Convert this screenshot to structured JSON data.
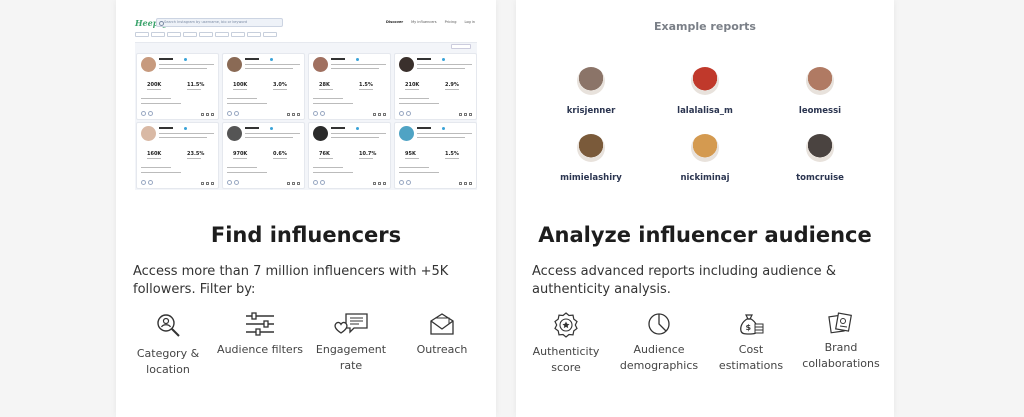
{
  "left": {
    "mini_app": {
      "logo": "Heepsy",
      "search_placeholder": "Search Instagram by username, bio or keyword",
      "nav": [
        "Discover",
        "My influencers",
        "Pricing",
        "Log in"
      ],
      "cards": [
        {
          "followers": "200K",
          "engagement": "11.5%",
          "avatar_color": "#c79a7e"
        },
        {
          "followers": "100K",
          "engagement": "3.0%",
          "avatar_color": "#8a6a55"
        },
        {
          "followers": "28K",
          "engagement": "1.5%",
          "avatar_color": "#a07060"
        },
        {
          "followers": "210K",
          "engagement": "2.9%",
          "avatar_color": "#3a302c"
        },
        {
          "followers": "160K",
          "engagement": "23.5%",
          "avatar_color": "#d9b9a5"
        },
        {
          "followers": "970K",
          "engagement": "0.6%",
          "avatar_color": "#555555"
        },
        {
          "followers": "76K",
          "engagement": "10.7%",
          "avatar_color": "#2a2a2a"
        },
        {
          "followers": "95K",
          "engagement": "1.5%",
          "avatar_color": "#4fa3c4"
        }
      ]
    },
    "heading": "Find influencers",
    "description": "Access more than 7 million influencers with +5K followers. Filter by:",
    "features": [
      {
        "label": "Category & location",
        "icon": "magnifier-search-icon"
      },
      {
        "label": "Audience filters",
        "icon": "sliders-icon"
      },
      {
        "label": "Engagement rate",
        "icon": "chat-heart-icon"
      },
      {
        "label": "Outreach",
        "icon": "envelope-icon"
      }
    ]
  },
  "right": {
    "example_title": "Example reports",
    "examples": [
      {
        "name": "krisjenner",
        "avatar_color": "#8b7468"
      },
      {
        "name": "lalalalisa_m",
        "avatar_color": "#c0392b"
      },
      {
        "name": "leomessi",
        "avatar_color": "#b07a63"
      },
      {
        "name": "mimielashiry",
        "avatar_color": "#7a5a3a"
      },
      {
        "name": "nickiminaj",
        "avatar_color": "#d49a50"
      },
      {
        "name": "tomcruise",
        "avatar_color": "#4a4340"
      }
    ],
    "heading": "Analyze influencer audience",
    "description": "Access advanced reports including audience & authenticity analysis.",
    "features": [
      {
        "label": "Authenticity score",
        "icon": "award-badge-icon"
      },
      {
        "label": "Audience demographics",
        "icon": "pie-chart-icon"
      },
      {
        "label": "Cost estimations",
        "icon": "money-bag-icon"
      },
      {
        "label": "Brand collaborations",
        "icon": "brand-cards-icon"
      }
    ]
  }
}
